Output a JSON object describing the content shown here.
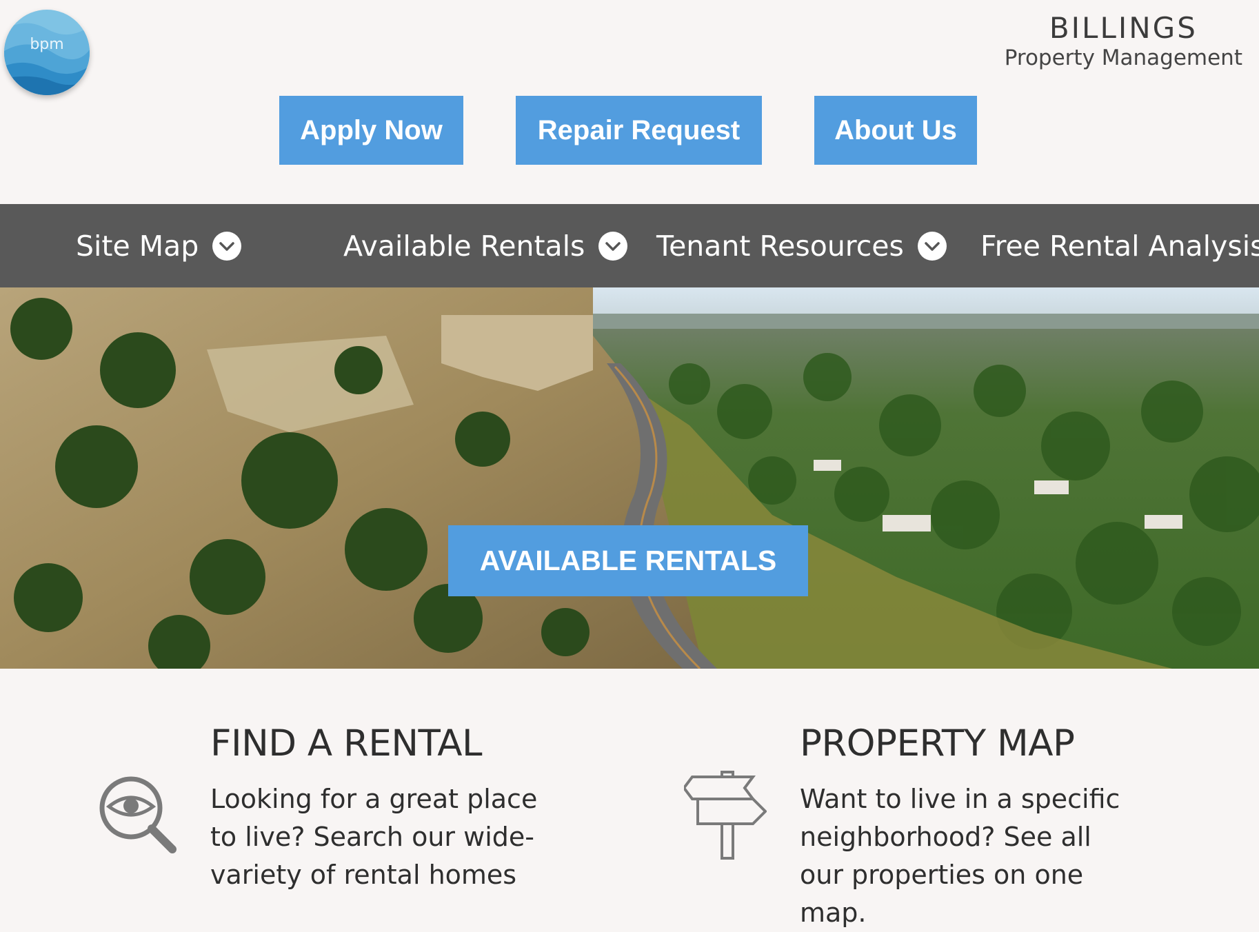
{
  "logo": {
    "text": "bpm"
  },
  "brand": {
    "name": "BILLINGS",
    "subtitle": "Property Management"
  },
  "actions": {
    "apply": "Apply Now",
    "repair": "Repair Request",
    "about": "About Us"
  },
  "nav": {
    "items": [
      {
        "label": "Site Map",
        "icon": "chevron-down-icon"
      },
      {
        "label": "Available Rentals",
        "icon": "chevron-down-icon"
      },
      {
        "label": "Tenant Resources",
        "icon": "chevron-down-icon"
      },
      {
        "label": "Free Rental Analysis"
      }
    ]
  },
  "hero": {
    "button": "AVAILABLE RENTALS"
  },
  "features": {
    "find": {
      "title": "FIND A RENTAL",
      "text": "Looking for a great place to live? Search our wide-variety of rental homes",
      "icon": "search-eye-icon"
    },
    "map": {
      "title": "PROPERTY MAP",
      "text": "Want to live in a specific neighborhood? See all our properties on one map.",
      "icon": "signpost-icon"
    }
  },
  "colors": {
    "accent": "#529ddf",
    "nav_bg": "#595959",
    "page_bg": "#f8f5f4"
  }
}
